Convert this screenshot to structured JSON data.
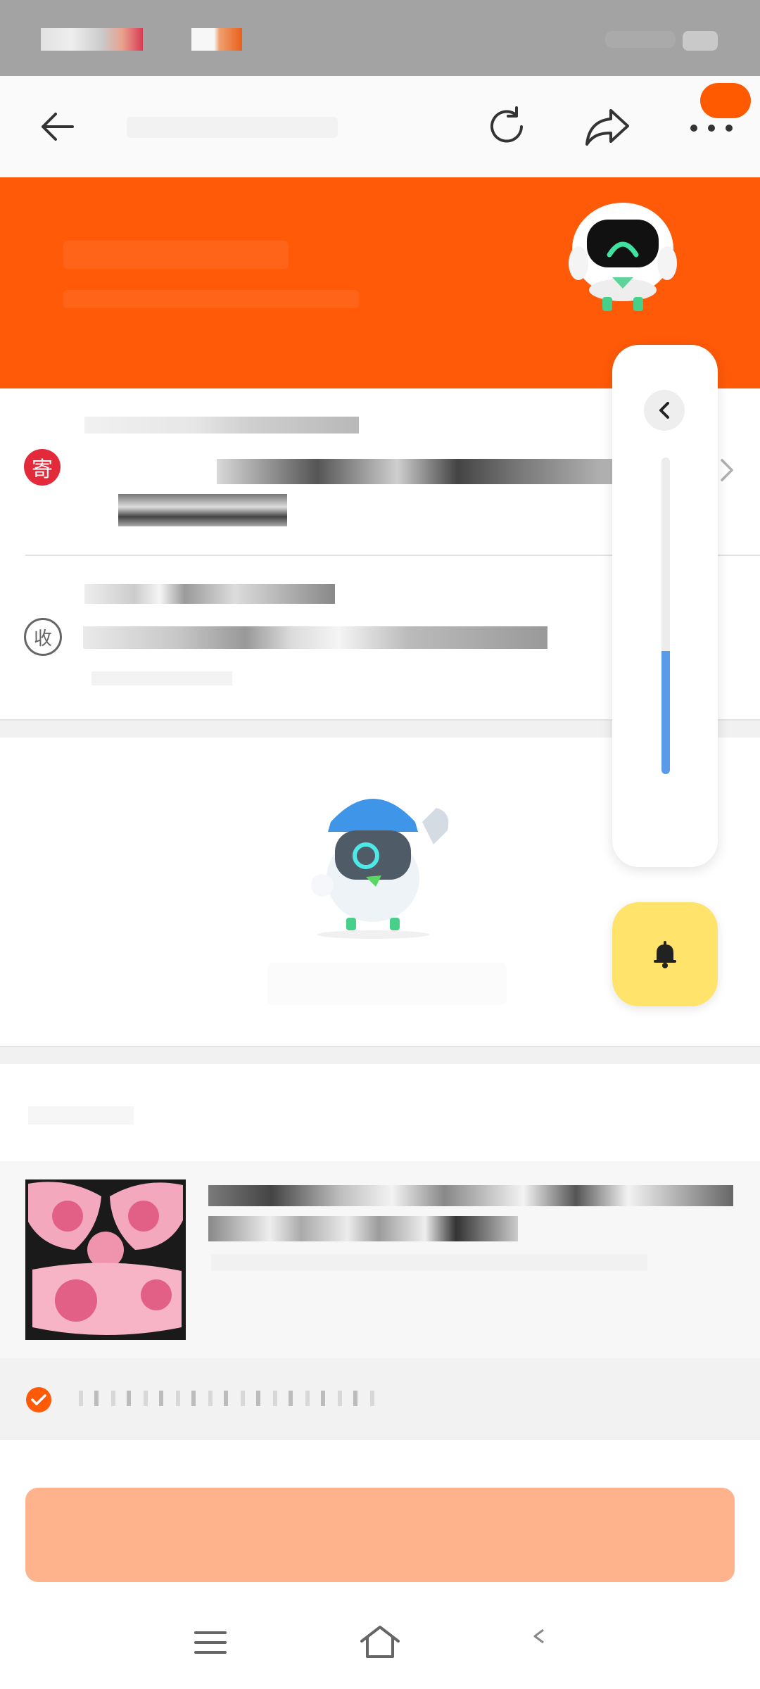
{
  "header": {
    "back_icon": "arrow-left-icon",
    "refresh_icon": "refresh-icon",
    "share_icon": "share-icon",
    "more_icon": "more-dots-icon"
  },
  "address": {
    "sender_badge": "寄",
    "receiver_badge": "收",
    "chevron_icon": "chevron-right-icon"
  },
  "floating_panel": {
    "collapse_icon": "chevron-left-icon",
    "slider_level_percent": 39,
    "bell_icon": "bell-icon"
  },
  "product": {
    "image_icon": "product-thumbnail",
    "confirm_icon": "check-circle-icon"
  },
  "nav": {
    "menu_icon": "menu-icon",
    "home_icon": "home-icon",
    "back_icon": "back-triangle-icon"
  },
  "colors": {
    "brand_orange": "#ff5a08",
    "submit_disabled": "#ffb38c",
    "bell_yellow": "#ffe36a",
    "slider_blue": "#5b9ae8",
    "sender_red": "#e32a3a"
  }
}
